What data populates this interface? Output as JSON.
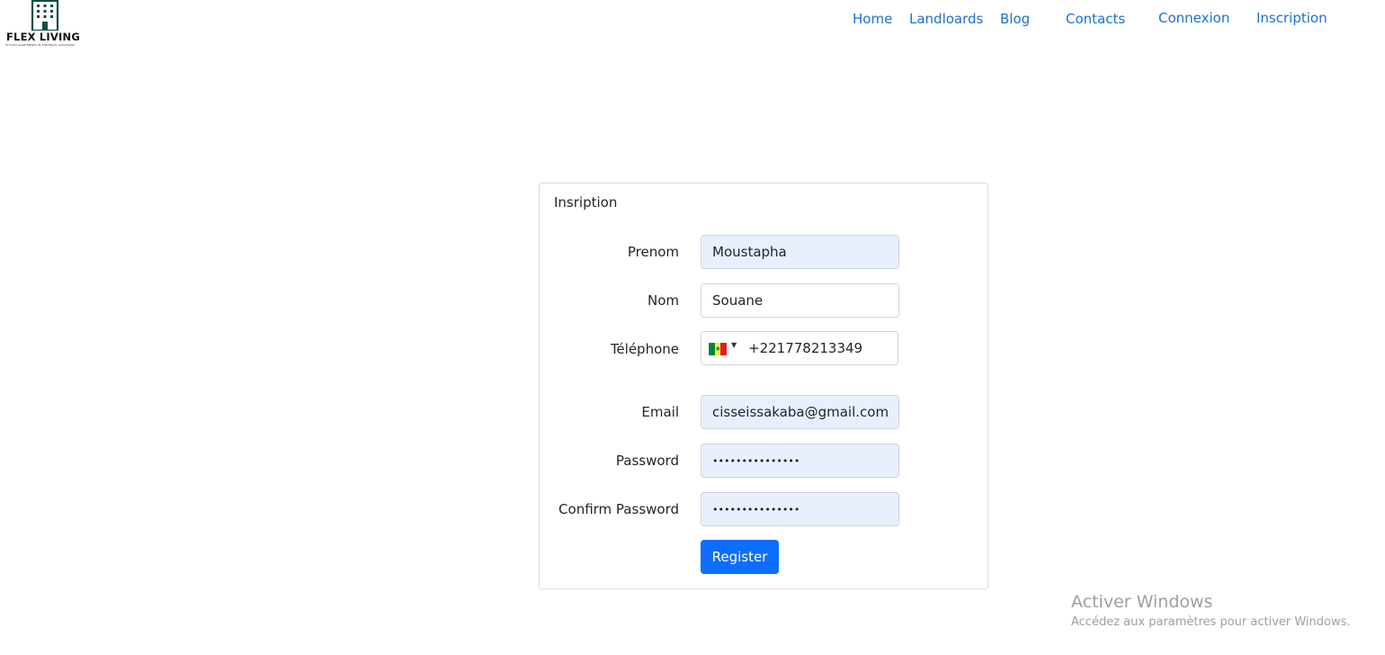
{
  "brand": {
    "name": "FLEX LIVING",
    "tagline": "STYLISH APARTMENTS IN STRATEGIC LOCATIONS",
    "color": "#0e4d4a"
  },
  "nav": {
    "items": [
      {
        "label": "Home"
      },
      {
        "label": "Landloards"
      },
      {
        "label": "Blog"
      },
      {
        "label": "Contacts"
      },
      {
        "label": "Connexion"
      },
      {
        "label": "Inscription"
      }
    ],
    "color": "#1a6fd6"
  },
  "form": {
    "title": "Insription",
    "fields": {
      "prenom": {
        "label": "Prenom",
        "value": "Moustapha"
      },
      "nom": {
        "label": "Nom",
        "value": "Souane"
      },
      "telephone": {
        "label": "Téléphone",
        "value": "+221778213349",
        "country_flag": "senegal-flag-icon"
      },
      "email": {
        "label": "Email",
        "value": "cisseissakaba@gmail.com"
      },
      "password": {
        "label": "Password",
        "value": "•••••••••••••••"
      },
      "confirm_password": {
        "label": "Confirm Password",
        "value": "•••••••••••••••"
      }
    },
    "submit_label": "Register",
    "submit_color": "#0d6efd"
  },
  "watermark": {
    "title": "Activer Windows",
    "subtitle": "Accédez aux paramètres pour activer Windows."
  }
}
